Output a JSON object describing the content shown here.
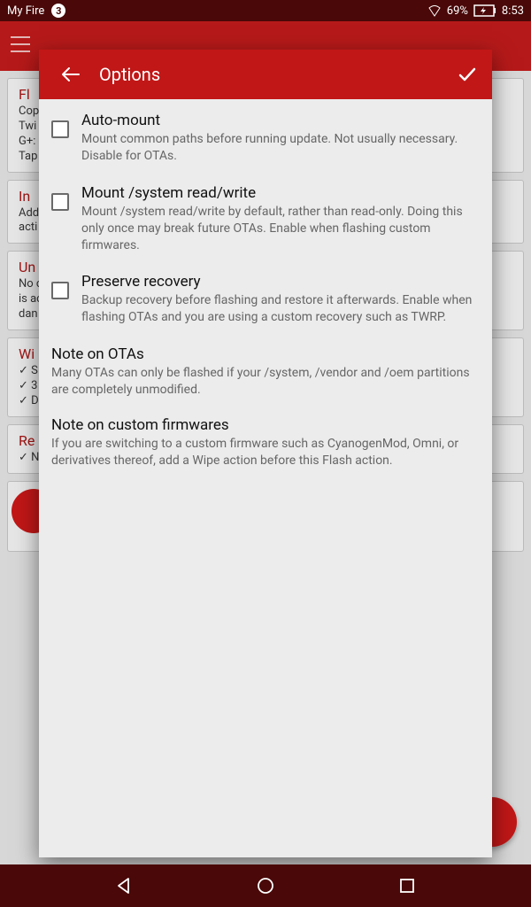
{
  "status": {
    "device_name": "My Fire",
    "notification_count": "3",
    "battery": "69%",
    "clock": "8:53"
  },
  "bg": {
    "cards": [
      {
        "title": "Fl",
        "body": "Cop\nTwi\nG+:\nTap"
      },
      {
        "title": "In",
        "body": "Add\nacti"
      },
      {
        "title": "Un",
        "body": "No c                                                                                                             on\nis ac\ndan"
      },
      {
        "title": "Wi",
        "body": "✓ S\n✓ 3\n✓ D"
      },
      {
        "title": "Re",
        "body": "✓ N"
      }
    ]
  },
  "modal": {
    "title": "Options",
    "options": [
      {
        "title": "Auto-mount",
        "desc": "Mount common paths before running update. Not usually necessary. Disable for OTAs."
      },
      {
        "title": "Mount /system read/write",
        "desc": "Mount /system read/write by default, rather than read-only. Doing this only once may break future OTAs. Enable when flashing custom firmwares."
      },
      {
        "title": "Preserve recovery",
        "desc": "Backup recovery before flashing and restore it afterwards. Enable when flashing OTAs and you are using a custom recovery such as TWRP."
      }
    ],
    "notes": [
      {
        "title": "Note on OTAs",
        "body": "Many OTAs can only be flashed if your /system, /vendor and /oem partitions are completely unmodified."
      },
      {
        "title": "Note on custom firmwares",
        "body": "If you are switching to a custom firmware such as CyanogenMod, Omni, or derivatives thereof, add a Wipe action before this Flash action."
      }
    ]
  }
}
